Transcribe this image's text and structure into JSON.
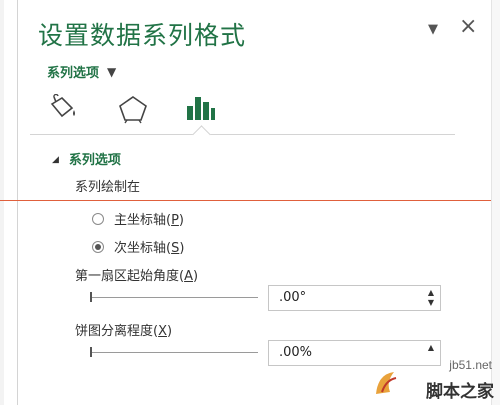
{
  "pane": {
    "title": "设置数据系列格式",
    "dropdown_icon": "caret-down-icon",
    "close_icon": "close-icon",
    "close_symbol": "×",
    "dropdown_symbol": "▼"
  },
  "series_menu": {
    "label": "系列选项",
    "caret": "▼"
  },
  "tabs": [
    {
      "name": "fill-line",
      "icon": "paint-bucket-icon",
      "selected": false
    },
    {
      "name": "effects",
      "icon": "pentagon-icon",
      "selected": false
    },
    {
      "name": "series-options",
      "icon": "bar-chart-icon",
      "selected": true
    }
  ],
  "section": {
    "label": "系列选项",
    "triangle": "◢"
  },
  "plot_on": {
    "label": "系列绘制在",
    "options": [
      {
        "label": "主坐标轴(",
        "key": "P",
        "suffix": ")",
        "checked": false
      },
      {
        "label": "次坐标轴(",
        "key": "S",
        "suffix": ")",
        "checked": true
      }
    ]
  },
  "first_slice_angle": {
    "label": "第一扇区起始角度(",
    "key": "A",
    "suffix": ")",
    "value": ".00°",
    "level": 0
  },
  "pie_explosion": {
    "label": "饼图分离程度(",
    "key": "X",
    "suffix": ")",
    "value": ".00%",
    "level": 0
  },
  "spinner": {
    "up": "▲",
    "down": "▼"
  },
  "watermark": {
    "url": "jb51.net",
    "text": "脚本之家"
  },
  "colors": {
    "accent_green": "#217346",
    "divider_red": "#e0603c"
  }
}
